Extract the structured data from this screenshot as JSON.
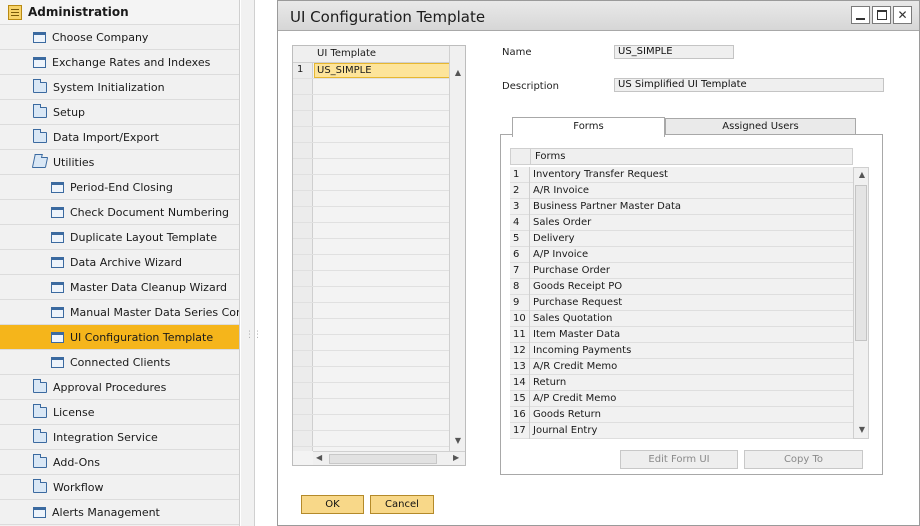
{
  "sidebar": {
    "header": "Administration",
    "items": [
      {
        "label": "Choose Company",
        "icon": "window-icon",
        "level": 1
      },
      {
        "label": "Exchange Rates and Indexes",
        "icon": "window-icon",
        "level": 1
      },
      {
        "label": "System Initialization",
        "icon": "folder-icon",
        "level": 1
      },
      {
        "label": "Setup",
        "icon": "folder-icon",
        "level": 1
      },
      {
        "label": "Data Import/Export",
        "icon": "folder-icon",
        "level": 1
      },
      {
        "label": "Utilities",
        "icon": "folder-open-icon",
        "level": 1
      },
      {
        "label": "Period-End Closing",
        "icon": "window-icon",
        "level": 2
      },
      {
        "label": "Check Document Numbering",
        "icon": "window-icon",
        "level": 2
      },
      {
        "label": "Duplicate Layout Template",
        "icon": "window-icon",
        "level": 2
      },
      {
        "label": "Data Archive Wizard",
        "icon": "window-icon",
        "level": 2
      },
      {
        "label": "Master Data Cleanup Wizard",
        "icon": "window-icon",
        "level": 2
      },
      {
        "label": "Manual Master Data Series Convert",
        "icon": "window-icon",
        "level": 2
      },
      {
        "label": "UI Configuration Template",
        "icon": "window-icon",
        "level": 2,
        "selected": true
      },
      {
        "label": "Connected Clients",
        "icon": "window-icon",
        "level": 2
      },
      {
        "label": "Approval Procedures",
        "icon": "folder-icon",
        "level": 1
      },
      {
        "label": "License",
        "icon": "folder-icon",
        "level": 1
      },
      {
        "label": "Integration Service",
        "icon": "folder-icon",
        "level": 1
      },
      {
        "label": "Add-Ons",
        "icon": "folder-icon",
        "level": 1
      },
      {
        "label": "Workflow",
        "icon": "folder-icon",
        "level": 1
      },
      {
        "label": "Alerts Management",
        "icon": "window-icon",
        "level": 1
      }
    ]
  },
  "window": {
    "title": "UI Configuration Template",
    "controls": {
      "close": "✕"
    }
  },
  "template_grid": {
    "header": "UI Template",
    "rows": [
      {
        "num": "1",
        "value": "US_SIMPLE"
      }
    ]
  },
  "fields": {
    "name_label": "Name",
    "name_value": "US_SIMPLE",
    "description_label": "Description",
    "description_value": "US Simplified UI Template"
  },
  "tabs": [
    {
      "label": "Forms",
      "active": true
    },
    {
      "label": "Assigned Users",
      "active": false
    }
  ],
  "forms_grid": {
    "header": "Forms",
    "rows": [
      {
        "num": "1",
        "name": "Inventory Transfer Request"
      },
      {
        "num": "2",
        "name": "A/R Invoice"
      },
      {
        "num": "3",
        "name": "Business Partner Master Data"
      },
      {
        "num": "4",
        "name": "Sales Order"
      },
      {
        "num": "5",
        "name": "Delivery"
      },
      {
        "num": "6",
        "name": "A/P Invoice"
      },
      {
        "num": "7",
        "name": "Purchase Order"
      },
      {
        "num": "8",
        "name": "Goods Receipt PO"
      },
      {
        "num": "9",
        "name": "Purchase Request"
      },
      {
        "num": "10",
        "name": "Sales Quotation"
      },
      {
        "num": "11",
        "name": "Item Master Data"
      },
      {
        "num": "12",
        "name": "Incoming Payments"
      },
      {
        "num": "13",
        "name": "A/R Credit Memo"
      },
      {
        "num": "14",
        "name": "Return"
      },
      {
        "num": "15",
        "name": "A/P Credit Memo"
      },
      {
        "num": "16",
        "name": "Goods Return"
      },
      {
        "num": "17",
        "name": "Journal Entry"
      }
    ]
  },
  "buttons": {
    "edit_form_ui": "Edit Form UI",
    "copy_to": "Copy To",
    "ok": "OK",
    "cancel": "Cancel"
  },
  "colors": {
    "selection": "#f5b51b",
    "grid_selection": "#fde49a",
    "primary_button": "#f8d889"
  }
}
